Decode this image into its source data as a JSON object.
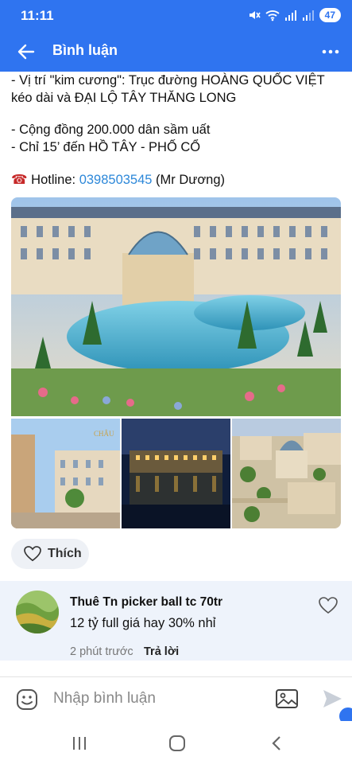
{
  "status_bar": {
    "time": "11:11",
    "battery": "47"
  },
  "app_bar": {
    "title": "Bình luận"
  },
  "post": {
    "lines": [
      "- Vị trí \"kim cương\": Trục đường HOÀNG QUỐC VIỆT",
      "kéo dài và ĐẠI LỘ TÂY THĂNG LONG",
      "- Cộng đồng 200.000 dân sầm uất",
      "- Chỉ 15’ đến HỒ TÂY - PHỐ CỔ"
    ],
    "hotline_label": "Hotline: ",
    "hotline_number": "0398503545",
    "hotline_contact": " (Mr Dương)",
    "image_caption": "CHÂU"
  },
  "like_label": "Thích",
  "comment": {
    "author": "Thuê Tn picker ball tc 70tr",
    "text": "12 tỷ full giá hay 30% nhỉ",
    "time": "2 phút trước",
    "reply_label": "Trả lời"
  },
  "input": {
    "placeholder": "Nhập bình luận"
  },
  "colors": {
    "primary": "#2f74f0",
    "link": "#2d88d9",
    "comment_bg": "#eef3fb"
  }
}
